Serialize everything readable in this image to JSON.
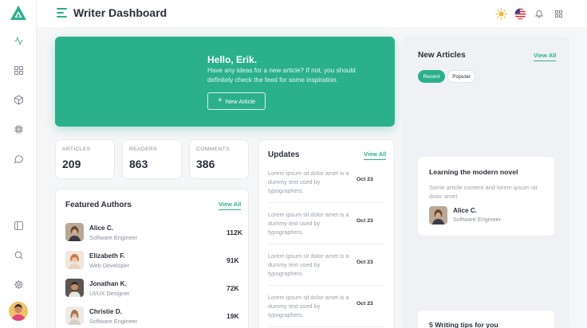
{
  "app": {
    "title": "Writer Dashboard"
  },
  "colors": {
    "accent": "#2bb08c",
    "text": "#2a2f3a",
    "muted": "#8a919c"
  },
  "sidebar": {
    "top_items": [
      {
        "icon": "activity-icon",
        "active": true
      },
      {
        "icon": "grid-icon"
      },
      {
        "icon": "box-icon"
      },
      {
        "icon": "cpu-icon"
      },
      {
        "icon": "chat-icon"
      }
    ],
    "bottom_items": [
      {
        "icon": "sidebar-toggle-icon"
      },
      {
        "icon": "search-icon"
      },
      {
        "icon": "settings-icon"
      }
    ]
  },
  "header": {
    "icons": [
      "sun-icon",
      "us-flag-icon",
      "bell-icon",
      "apps-grid-icon"
    ]
  },
  "hero": {
    "title": "Hello, Erik.",
    "text": "Have any ideas for a new article? If not, you should definitely check the feed for some inspiration.",
    "button": "New Article"
  },
  "stats": [
    {
      "label": "ARTICLES",
      "value": "209"
    },
    {
      "label": "READERS",
      "value": "863"
    },
    {
      "label": "COMMENTS",
      "value": "386"
    }
  ],
  "featured_authors": {
    "title": "Featured Authors",
    "view_all": "View All",
    "items": [
      {
        "name": "Alice C.",
        "role": "Software Engineer",
        "count": "112K"
      },
      {
        "name": "Elizabeth F.",
        "role": "Web Developer",
        "count": "91K"
      },
      {
        "name": "Jonathan K.",
        "role": "UI/UX Designer",
        "count": "72K"
      },
      {
        "name": "Christie D.",
        "role": "Software Engineer",
        "count": "19K"
      }
    ]
  },
  "updates": {
    "title": "Updates",
    "view_all": "View All",
    "items": [
      {
        "text": "Lorem ipsum sit dolor amet is a dummy text used by typographers.",
        "date": "Oct 23"
      },
      {
        "text": "Lorem ipsum sit dolor amet is a dummy text used by typographers.",
        "date": "Oct 23"
      },
      {
        "text": "Lorem ipsum sit dolor amet is a dummy text used by typographers.",
        "date": "Oct 23"
      },
      {
        "text": "Lorem ipsum sit dolor amet is a dummy text used by typographers.",
        "date": "Oct 23"
      }
    ]
  },
  "new_articles": {
    "title": "New Articles",
    "view_all": "View All",
    "tabs": [
      "Recent",
      "Popular"
    ],
    "active_tab": "Recent",
    "cards": [
      {
        "title": "Learning the modern novel",
        "excerpt": "Some article content and lorem ipsum sit dolor amet",
        "author": "Alice C.",
        "role": "Software Engineer"
      },
      {
        "title": "5 Writing tips for you"
      }
    ]
  }
}
